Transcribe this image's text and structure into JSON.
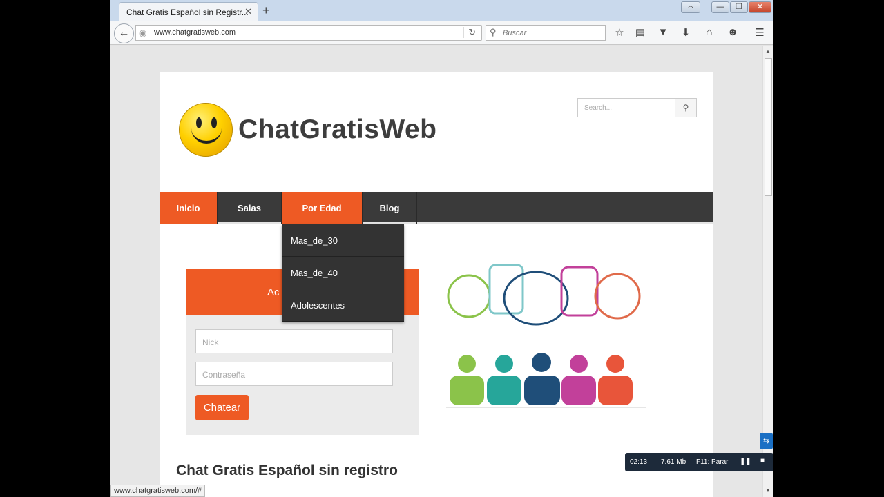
{
  "browser": {
    "tab_title": "Chat Gratis Español sin Registr...",
    "tab_close": "✕",
    "new_tab": "+",
    "url": "www.chatgratisweb.com",
    "search_placeholder": "Buscar",
    "window_buttons": {
      "restore": "⇔",
      "minimize": "—",
      "maximize": "❐",
      "close": "✕"
    }
  },
  "site": {
    "name": "ChatGratisWeb",
    "search_placeholder": "Search...",
    "menu": [
      {
        "label": "Inicio"
      },
      {
        "label": "Salas"
      },
      {
        "label": "Por Edad"
      },
      {
        "label": "Blog"
      }
    ],
    "dropdown": [
      {
        "label": "Mas_de_30"
      },
      {
        "label": "Mas_de_40"
      },
      {
        "label": "Adolescentes"
      }
    ],
    "login": {
      "title": "Ac",
      "nick_placeholder": "Nick",
      "password_placeholder": "Contraseña",
      "button": "Chatear"
    },
    "heading": "Chat Gratis Español sin registro"
  },
  "status_url": "www.chatgratisweb.com/#",
  "recorder": {
    "time": "02:13",
    "size": "7.61 Mb",
    "stop_hint": "F11: Parar"
  },
  "colors": {
    "accent": "#ee5a24",
    "menu_bg": "#3a3a3a"
  }
}
